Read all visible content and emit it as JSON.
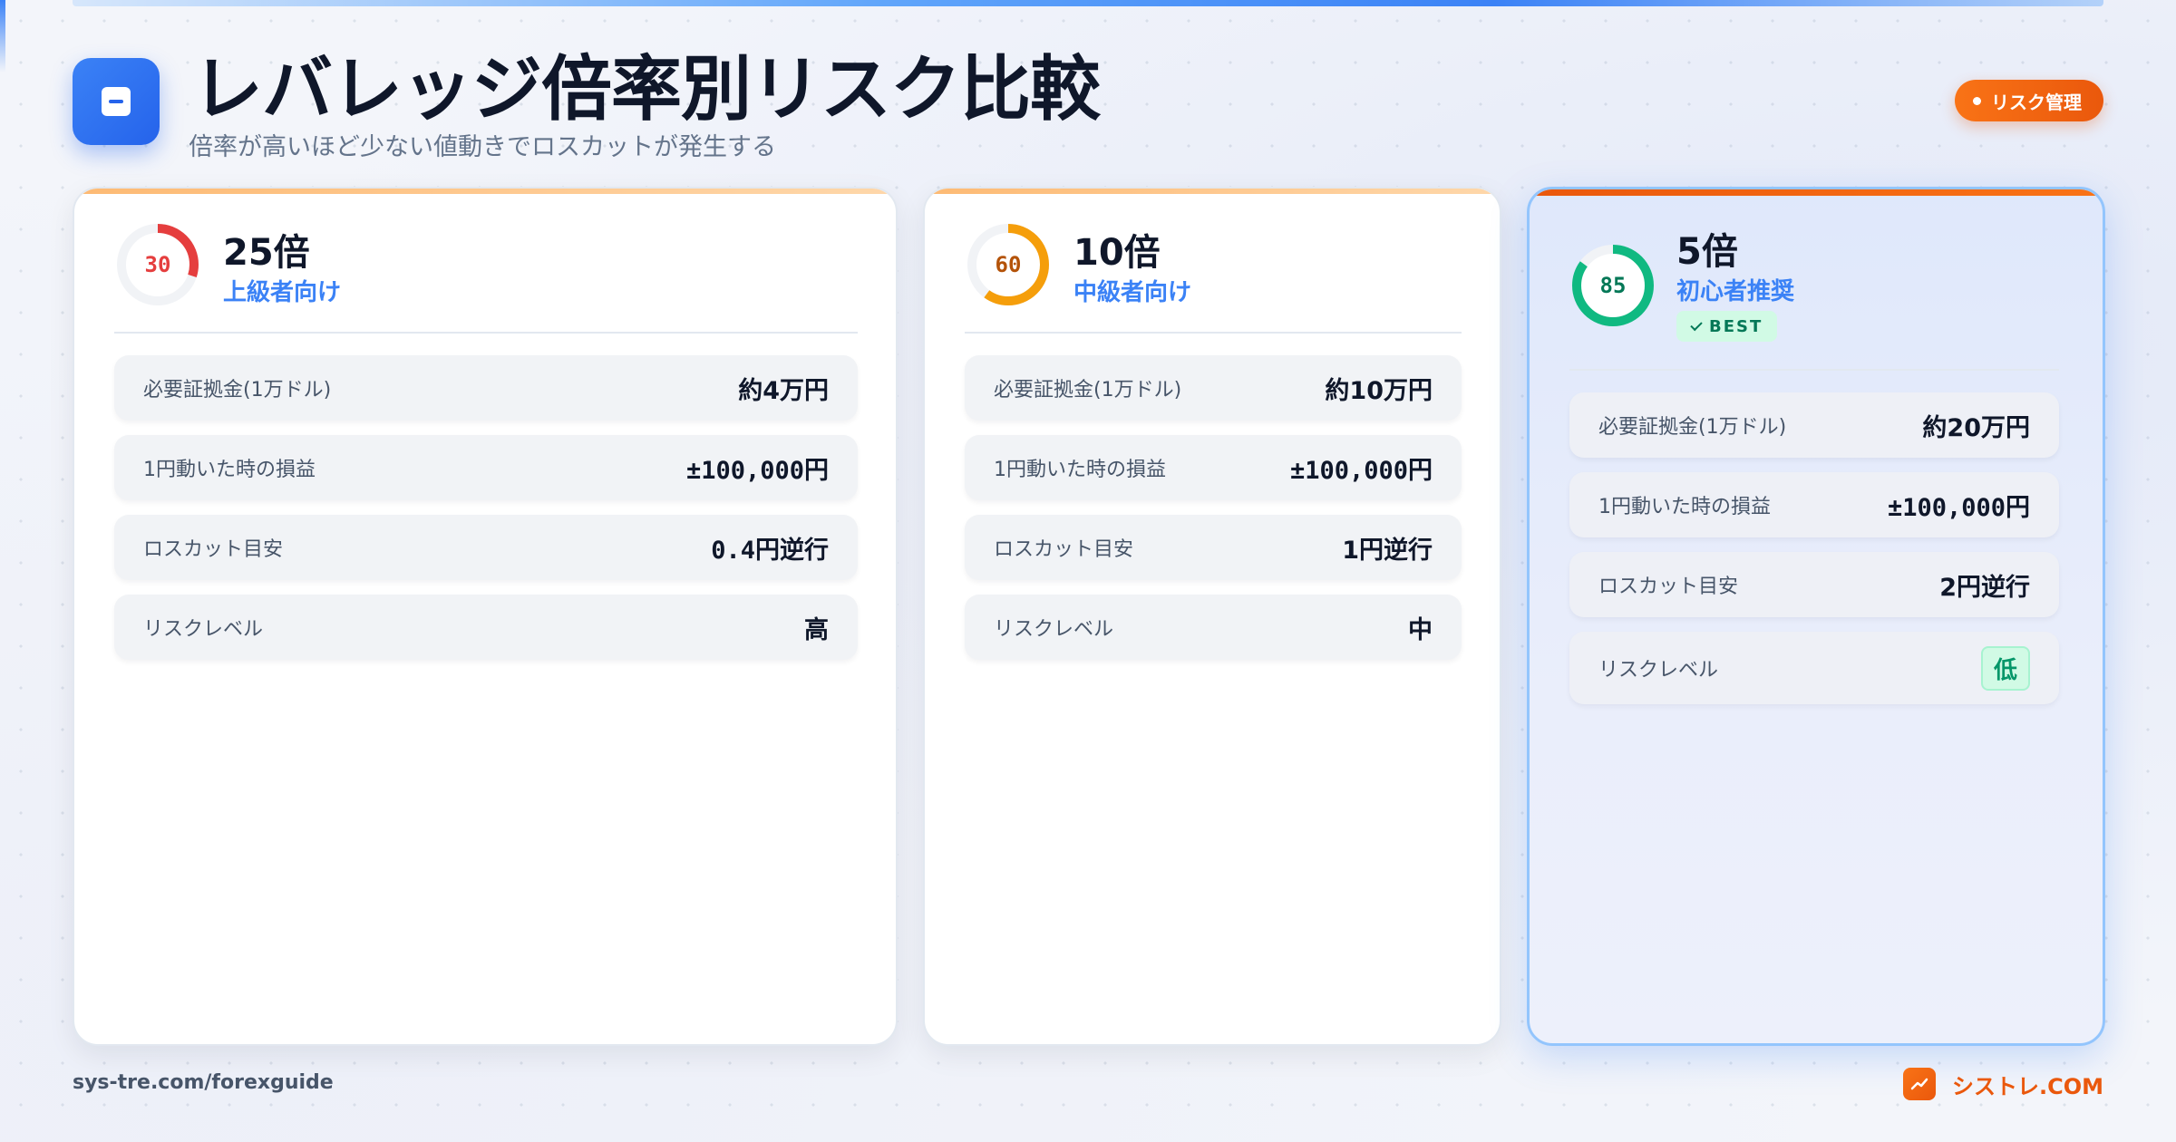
{
  "header": {
    "title": "レバレッジ倍率別リスク比較",
    "subtitle": "倍率が高いほど少ない値動きでロスカットが発生する",
    "tag": "リスク管理"
  },
  "cards": [
    {
      "gauge": 30,
      "gauge_color": "#e53e3e",
      "leverage": "25倍",
      "level": "上級者向け",
      "rows": [
        {
          "label": "必要証拠金(1万ドル)",
          "value": "約4万円"
        },
        {
          "label": "1円動いた時の損益",
          "value": "±100,000円"
        },
        {
          "label": "ロスカット目安",
          "value": "0.4円逆行"
        },
        {
          "label": "リスクレベル",
          "value": "高"
        }
      ]
    },
    {
      "gauge": 60,
      "gauge_color": "#f59e0b",
      "leverage": "10倍",
      "level": "中級者向け",
      "rows": [
        {
          "label": "必要証拠金(1万ドル)",
          "value": "約10万円"
        },
        {
          "label": "1円動いた時の損益",
          "value": "±100,000円"
        },
        {
          "label": "ロスカット目安",
          "value": "1円逆行"
        },
        {
          "label": "リスクレベル",
          "value": "中"
        }
      ]
    },
    {
      "gauge": 85,
      "gauge_color": "#10b981",
      "leverage": "5倍",
      "level": "初心者推奨",
      "badge": "BEST",
      "rows": [
        {
          "label": "必要証拠金(1万ドル)",
          "value": "約20万円"
        },
        {
          "label": "1円動いた時の損益",
          "value": "±100,000円"
        },
        {
          "label": "ロスカット目安",
          "value": "2円逆行"
        },
        {
          "label": "リスクレベル",
          "value": "低"
        }
      ]
    }
  ],
  "footer": {
    "url": "sys-tre.com/forexguide",
    "brand": "シストレ.COM"
  }
}
